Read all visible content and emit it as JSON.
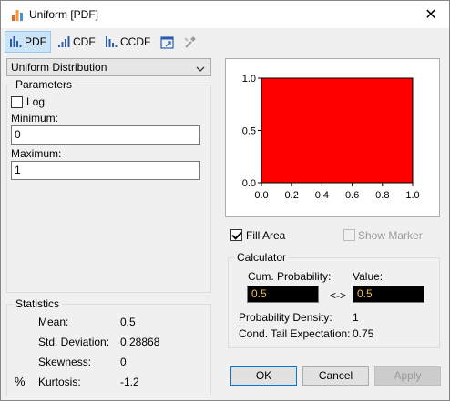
{
  "window": {
    "title": "Uniform [PDF]"
  },
  "toolbar": {
    "pdf_label": "PDF",
    "cdf_label": "CDF",
    "ccdf_label": "CCDF"
  },
  "distribution": {
    "selected": "Uniform Distribution"
  },
  "parameters": {
    "group_title": "Parameters",
    "log_label": "Log",
    "log_checked": false,
    "minimum_label": "Minimum:",
    "minimum_value": "0",
    "maximum_label": "Maximum:",
    "maximum_value": "1"
  },
  "statistics": {
    "group_title": "Statistics",
    "rows": [
      {
        "label": "Mean:",
        "value": "0.5"
      },
      {
        "label": "Std. Deviation:",
        "value": "0.28868"
      },
      {
        "label": "Skewness:",
        "value": "0"
      },
      {
        "label": "Kurtosis:",
        "value": "-1.2"
      }
    ],
    "percent_icon": "%"
  },
  "chart_data": {
    "type": "area",
    "x": [
      0.0,
      1.0
    ],
    "y": [
      1.0,
      1.0
    ],
    "fill_color": "#ff0000",
    "xlim": [
      0.0,
      1.0
    ],
    "ylim": [
      0.0,
      1.0
    ],
    "x_ticks": [
      "0.0",
      "0.2",
      "0.4",
      "0.6",
      "0.8",
      "1.0"
    ],
    "y_ticks": [
      "0.0",
      "0.5",
      "1.0"
    ],
    "title": "",
    "xlabel": "",
    "ylabel": ""
  },
  "options": {
    "fill_area_label": "Fill Area",
    "fill_area_checked": true,
    "show_marker_label": "Show Marker",
    "show_marker_checked": false
  },
  "calculator": {
    "group_title": "Calculator",
    "cum_prob_label": "Cum. Probability:",
    "cum_prob_value": "0.5",
    "arrow": "<->",
    "value_label": "Value:",
    "value_value": "0.5",
    "density_label": "Probability Density:",
    "density_value": "1",
    "tail_label": "Cond. Tail Expectation:",
    "tail_value": "0.75"
  },
  "buttons": {
    "ok": "OK",
    "cancel": "Cancel",
    "apply": "Apply"
  },
  "colors": {
    "accent": "#0078d7",
    "active_tab_bg": "#cce4f7",
    "input_text": "#f5c04a"
  }
}
